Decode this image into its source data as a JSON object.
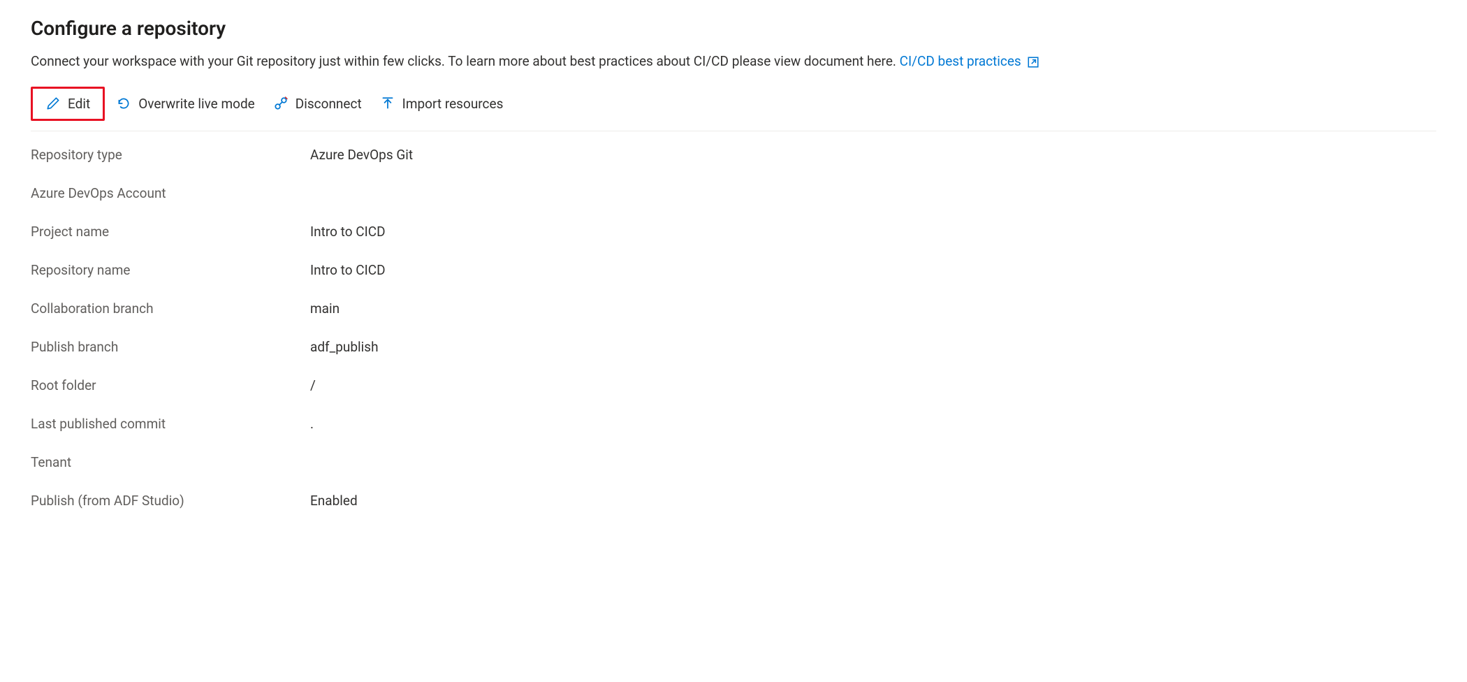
{
  "header": {
    "title": "Configure a repository",
    "description": "Connect your workspace with your Git repository just within few clicks. To learn more about best practices about CI/CD please view document here.",
    "link_text": "CI/CD best practices"
  },
  "toolbar": {
    "edit_label": "Edit",
    "overwrite_label": "Overwrite live mode",
    "disconnect_label": "Disconnect",
    "import_label": "Import resources"
  },
  "details": {
    "rows": [
      {
        "label": "Repository type",
        "value": "Azure DevOps Git"
      },
      {
        "label": "Azure DevOps Account",
        "value": ""
      },
      {
        "label": "Project name",
        "value": "Intro to CICD"
      },
      {
        "label": "Repository name",
        "value": "Intro to CICD"
      },
      {
        "label": "Collaboration branch",
        "value": "main"
      },
      {
        "label": "Publish branch",
        "value": "adf_publish"
      },
      {
        "label": "Root folder",
        "value": "/"
      },
      {
        "label": "Last published commit",
        "value": "."
      },
      {
        "label": "Tenant",
        "value": ""
      },
      {
        "label": "Publish (from ADF Studio)",
        "value": "Enabled"
      }
    ]
  }
}
